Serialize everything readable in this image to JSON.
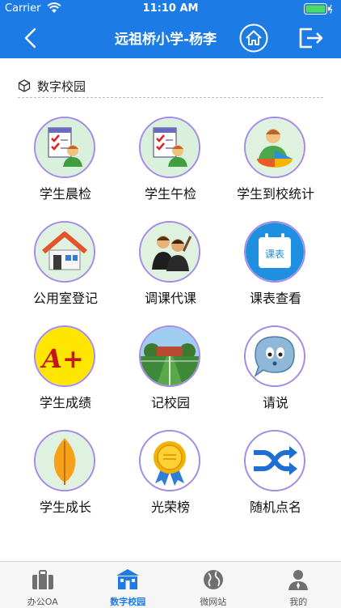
{
  "statusbar": {
    "carrier": "Carrier",
    "time": "11:10 AM"
  },
  "navbar": {
    "title": "远祖桥小学-杨李",
    "icons": [
      "back-icon",
      "home-icon",
      "logout-icon"
    ]
  },
  "section": {
    "title": "数字校园",
    "icon": "cube-icon"
  },
  "tiles": [
    {
      "label": "学生晨检",
      "icon": "checklist-person-icon"
    },
    {
      "label": "学生午检",
      "icon": "checklist-person-icon"
    },
    {
      "label": "学生到校统计",
      "icon": "person-chart-icon"
    },
    {
      "label": "公用室登记",
      "icon": "house-icon"
    },
    {
      "label": "调课代课",
      "icon": "teachers-icon"
    },
    {
      "label": "课表查看",
      "icon": "calendar-icon"
    },
    {
      "label": "学生成绩",
      "icon": "grade-a-plus-icon"
    },
    {
      "label": "记校园",
      "icon": "campus-photo-icon"
    },
    {
      "label": "请说",
      "icon": "speech-bubble-icon"
    },
    {
      "label": "学生成长",
      "icon": "leaf-icon"
    },
    {
      "label": "光荣榜",
      "icon": "medal-icon"
    },
    {
      "label": "随机点名",
      "icon": "shuffle-icon"
    }
  ],
  "calendar_badge": "课表",
  "grade_text": "A+",
  "tabbar": {
    "active_index": 1,
    "active_color": "#1d7be6",
    "items": [
      {
        "label": "办公OA",
        "icon": "briefcase-icon"
      },
      {
        "label": "数字校园",
        "icon": "school-icon"
      },
      {
        "label": "微网站",
        "icon": "globe-icon"
      },
      {
        "label": "我的",
        "icon": "user-icon"
      }
    ]
  }
}
